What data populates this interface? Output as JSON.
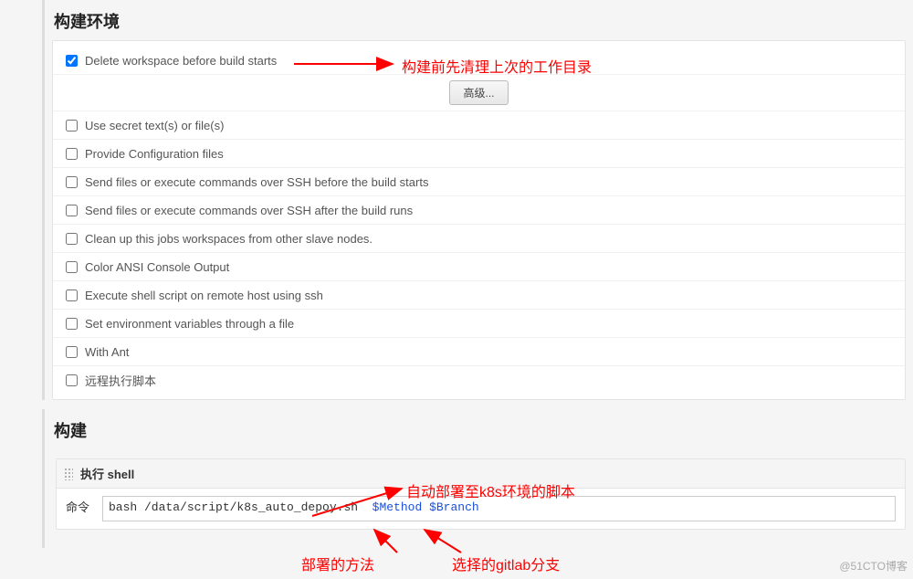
{
  "section_env": {
    "title": "构建环境",
    "checkbox_delete": {
      "checked": true,
      "label": "Delete workspace before build starts"
    },
    "adv_btn": "高级...",
    "items": [
      "Use secret text(s) or file(s)",
      "Provide Configuration files",
      "Send files or execute commands over SSH before the build starts",
      "Send files or execute commands over SSH after the build runs",
      "Clean up this jobs workspaces from other slave nodes.",
      "Color ANSI Console Output",
      "Execute shell script on remote host using ssh",
      "Set environment variables through a file",
      "With Ant",
      "远程执行脚本"
    ]
  },
  "section_build": {
    "title": "构建",
    "shell_title": "执行 shell",
    "cmd_label": "命令",
    "cmd_text_plain": "bash /data/script/k8s_auto_depoy.sh  ",
    "cmd_var1": "$Method",
    "cmd_sep": " ",
    "cmd_var2": "$Branch"
  },
  "annotations": {
    "a1": "构建前先清理上次的工作目录",
    "a2": "自动部署至k8s环境的脚本",
    "a3": "部署的方法",
    "a4": "选择的gitlab分支"
  },
  "watermark": "@51CTO博客"
}
